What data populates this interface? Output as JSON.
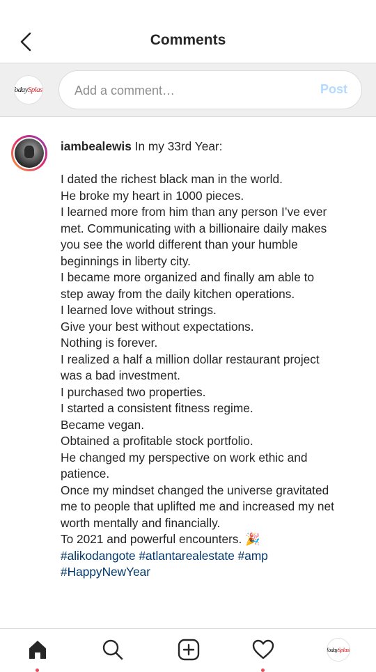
{
  "header": {
    "title": "Comments",
    "back_icon": "chevron-left-icon"
  },
  "comment_bar": {
    "avatar_logo": {
      "part1": "Today",
      "part2": "Splash"
    },
    "placeholder": "Add a comment…",
    "post_label": "Post"
  },
  "post": {
    "username": "iambealewis",
    "intro": "In my 33rd Year:",
    "lines": [
      "I dated the richest black man in the world.",
      "He broke my heart in 1000 pieces.",
      "I learned more from him than any person I’ve ever",
      "met. Communicating with a billionaire daily makes",
      "you see the world different than your humble",
      "beginnings in liberty city.",
      "I became more organized and finally am able to",
      "step away from the daily kitchen operations.",
      "I learned love without strings.",
      "Give your best without expectations.",
      "Nothing is forever.",
      "I realized a half a million dollar restaurant project",
      "was a bad investment.",
      "I purchased two properties.",
      "I started a consistent fitness regime.",
      "Became vegan.",
      "Obtained a profitable stock portfolio.",
      "He changed my perspective on work ethic and",
      "patience.",
      "Once my mindset changed the universe gravitated",
      "me to people that uplifted me and increased my net",
      "worth mentally and financially.",
      "To 2021 and powerful encounters. 🎉"
    ],
    "hashtags": [
      "#alikodangote",
      "#atlantarealestate",
      "#amp",
      "#HappyNewYear"
    ]
  },
  "bottom_nav": {
    "items": [
      "home-icon",
      "search-icon",
      "new-post-icon",
      "activity-heart-icon",
      "profile-avatar"
    ],
    "active_color": "#262626",
    "notification_color": "#ed4956"
  }
}
